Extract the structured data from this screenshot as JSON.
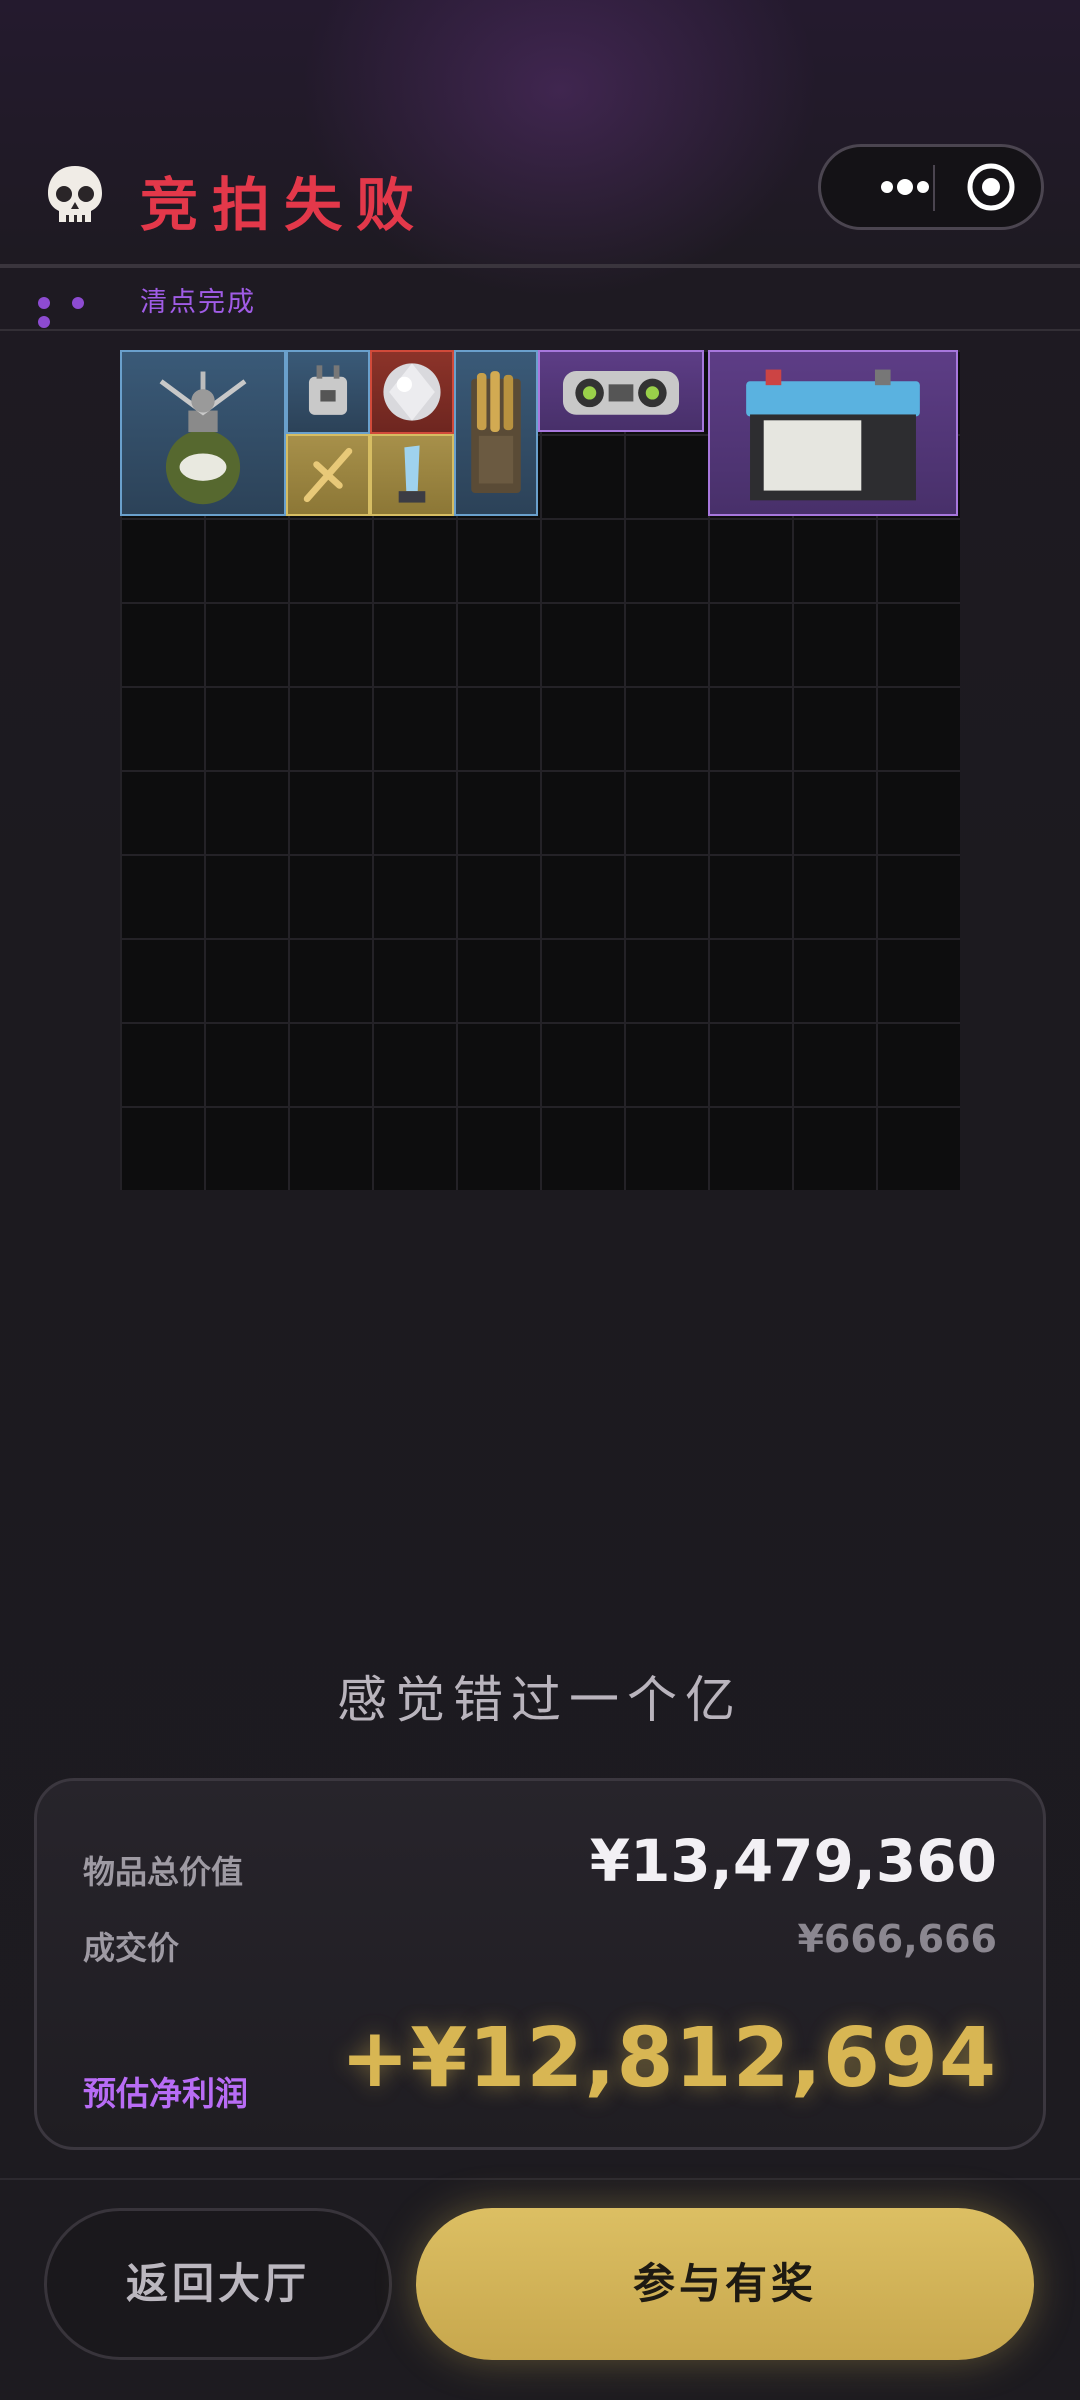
{
  "header": {
    "title": "竞拍失败",
    "skull_icon": "skull-icon",
    "menu_icon": "more-dots-icon",
    "close_icon": "target-circle-icon"
  },
  "status": {
    "text": "清点完成"
  },
  "inventory": {
    "grid_columns": 10,
    "grid_rows": 10,
    "items": [
      {
        "name": "camping-stove",
        "rarity": "blue"
      },
      {
        "name": "power-adapter",
        "rarity": "blue"
      },
      {
        "name": "diamond",
        "rarity": "red"
      },
      {
        "name": "golden-cross",
        "rarity": "gold"
      },
      {
        "name": "crystal-trophy",
        "rarity": "gold"
      },
      {
        "name": "bullet-box",
        "rarity": "blue"
      },
      {
        "name": "boombox",
        "rarity": "purple"
      },
      {
        "name": "car-battery",
        "rarity": "purple"
      }
    ]
  },
  "message": "感觉错过一个亿",
  "summary": {
    "total_label": "物品总价值",
    "total_value": "¥13,479,360",
    "price_label": "成交价",
    "price_value": "¥666,666",
    "profit_label": "预估净利润",
    "profit_value": "+¥12,812,694"
  },
  "buttons": {
    "back_label": "返回大厅",
    "join_label": "参与有奖"
  },
  "colors": {
    "title_red": "#e3384a",
    "accent_purple": "#a05ce6",
    "gold": "#d8b653"
  }
}
